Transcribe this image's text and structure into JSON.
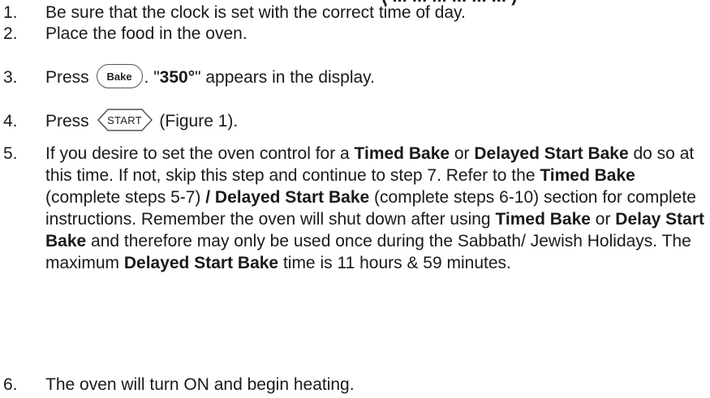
{
  "heading_fragment": "( ... ... ... ... ... ... )",
  "steps": [
    {
      "num": "1.",
      "text": "Be sure that the clock is set with the correct time of day."
    },
    {
      "num": "2.",
      "text": "Place the food in the oven."
    },
    {
      "num": "3.",
      "pre": "Press",
      "button": "Bake",
      "mid": ". \"",
      "bold": "350°",
      "post": "\" appears in the display."
    },
    {
      "num": "4.",
      "pre": "Press",
      "button": "START",
      "post": "(Figure 1)."
    },
    {
      "num": "5.",
      "t1": "If you desire to set the oven control for a ",
      "b1": "Timed Bake",
      "t2": " or ",
      "b2": "Delayed Start Bake",
      "t3": " do so at this time. If not, skip this step and continue to step 7. Refer to the ",
      "b3": "Timed Bake",
      "t4": " (complete steps 5-7) ",
      "b4": "/ Delayed Start Bake",
      "t5": " (complete steps 6-10) section for complete instructions. Remember the oven will shut down after using ",
      "b5": "Timed Bake",
      "t6": " or ",
      "b6": "Delay Start Bake",
      "t7": " and therefore may only be used once during the Sabbath/ Jewish Holidays. The maximum ",
      "b7": "Delayed Start Bake",
      "t8": " time is 11 hours & 59 minutes."
    },
    {
      "num": "6.",
      "text": "The oven will turn ON and begin heating."
    }
  ]
}
